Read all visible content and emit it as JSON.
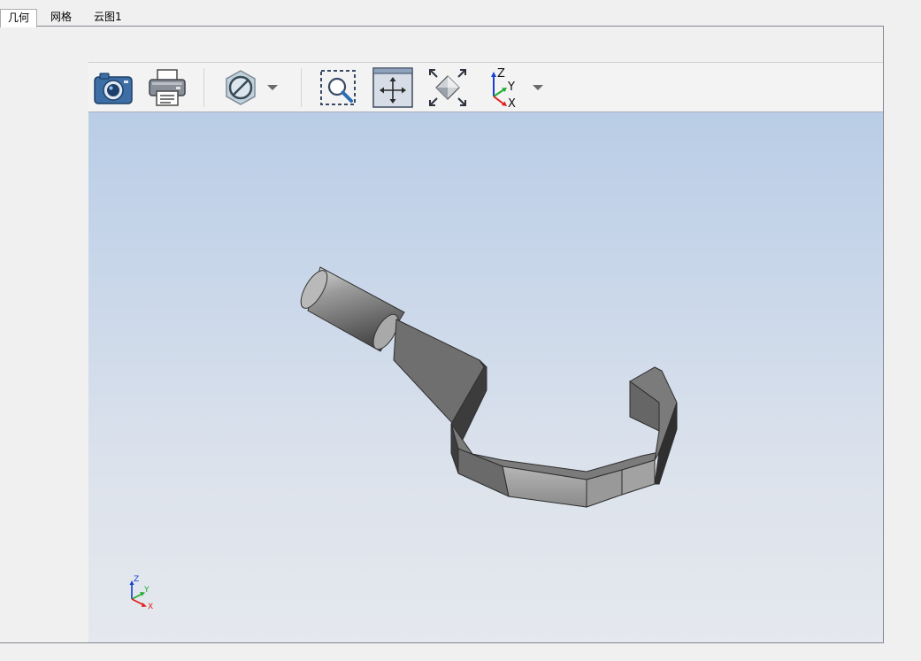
{
  "tabs": [
    {
      "label": "几何",
      "active": true
    },
    {
      "label": "网格",
      "active": false
    },
    {
      "label": "云图1",
      "active": false
    }
  ],
  "toolbar": {
    "tools": [
      {
        "icon": "camera-icon"
      },
      {
        "icon": "printer-icon"
      },
      {
        "icon": "section-disabled-icon"
      },
      {
        "icon": "chevron-down-icon"
      },
      {
        "icon": "zoom-region-icon"
      },
      {
        "icon": "pan-icon"
      },
      {
        "icon": "fit-view-icon"
      },
      {
        "icon": "axis-view-icon"
      },
      {
        "icon": "chevron-down-icon"
      }
    ],
    "axis_icon_labels": {
      "z": "Z",
      "y": "Y",
      "x": "X"
    }
  },
  "triad": {
    "z": "Z",
    "y": "Y",
    "x": "X"
  },
  "colors": {
    "axis_x": "#e0201b",
    "axis_y": "#1fae2c",
    "axis_z": "#1a3fd1",
    "model_gray": "#8c8c8c",
    "background_top": "#b9cde6",
    "background_bottom": "#e5e8ee"
  }
}
